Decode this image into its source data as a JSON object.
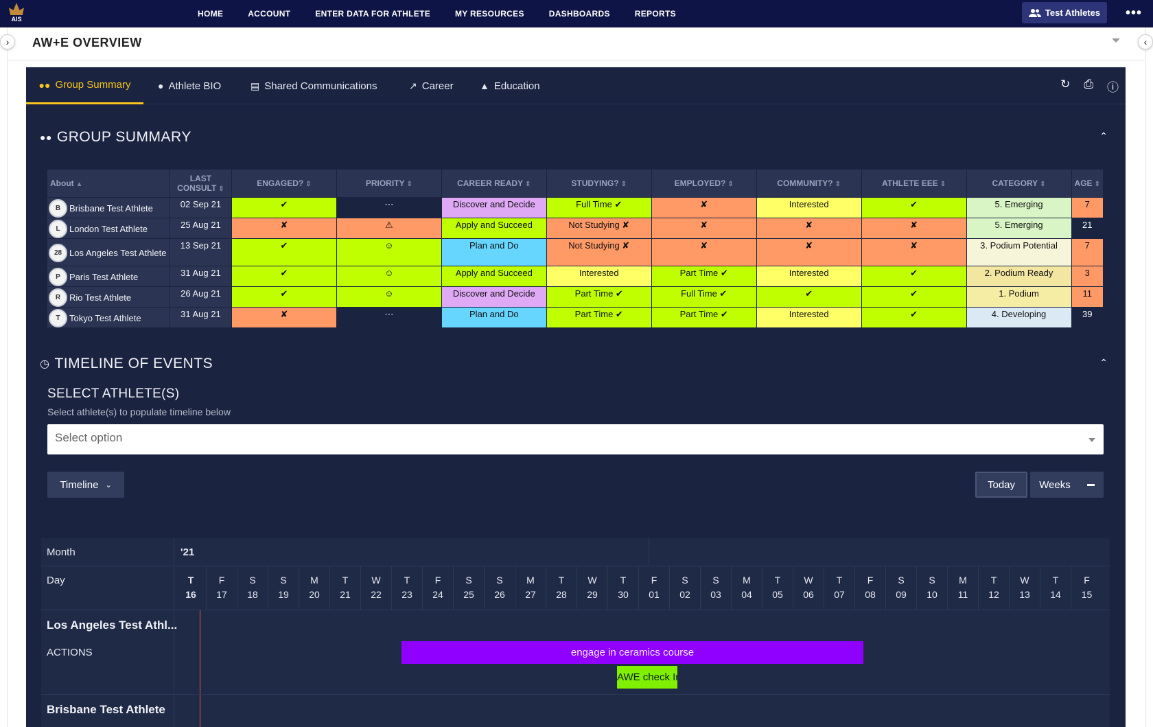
{
  "nav": {
    "logo_text": "AIS",
    "links": [
      "HOME",
      "ACCOUNT",
      "ENTER DATA FOR ATHLETE",
      "MY RESOURCES",
      "DASHBOARDS",
      "REPORTS"
    ],
    "team_button": "Test Athletes",
    "more": "•••"
  },
  "header": {
    "title": "AW+E OVERVIEW"
  },
  "tabs": [
    {
      "label": "Group Summary",
      "icon": "group-icon",
      "active": true
    },
    {
      "label": "Athlete BIO",
      "icon": "person-icon"
    },
    {
      "label": "Shared Communications",
      "icon": "chat-icon"
    },
    {
      "label": "Career",
      "icon": "chart-icon"
    },
    {
      "label": "Education",
      "icon": "graduation-cap-icon"
    }
  ],
  "tools": [
    "refresh-icon",
    "print-icon",
    "info-icon"
  ],
  "group_summary": {
    "title": "GROUP SUMMARY",
    "columns": [
      "About",
      "LAST CONSULT",
      "ENGAGED?",
      "PRIORITY",
      "CAREER READY",
      "STUDYING?",
      "EMPLOYED?",
      "COMMUNITY?",
      "ATHLETE EEE",
      "CATEGORY",
      "AGE"
    ],
    "rows": [
      {
        "name": "Brisbane Test Athlete",
        "date": "02 Sep 21",
        "engaged": "✔",
        "priority": "⋯",
        "career": "Discover and Decide",
        "studying": "Full Time ✔",
        "employed": "✘",
        "community": "Interested",
        "eee": "✔",
        "category": "5. Emerging",
        "age": "7"
      },
      {
        "name": "London Test Athlete",
        "date": "25 Aug 21",
        "engaged": "✘",
        "priority": "⚠",
        "career": "Apply and Succeed",
        "studying": "Not Studying ✘",
        "employed": "✘",
        "community": "✘",
        "eee": "✘",
        "category": "5. Emerging",
        "age": "21"
      },
      {
        "name": "Los Angeles Test Athlete",
        "date": "13 Sep 21",
        "engaged": "✔",
        "priority": "☺",
        "career": "Plan and Do",
        "studying": "Not Studying ✘",
        "employed": "✘",
        "community": "✘",
        "eee": "✘",
        "category": "3. Podium Potential",
        "age": "7"
      },
      {
        "name": "Paris Test Athlete",
        "date": "31 Aug 21",
        "engaged": "✔",
        "priority": "☺",
        "career": "Apply and Succeed",
        "studying": "Interested",
        "employed": "Part Time ✔",
        "community": "Interested",
        "eee": "✔",
        "category": "2. Podium Ready",
        "age": "3"
      },
      {
        "name": "Rio Test Athlete",
        "date": "26 Aug 21",
        "engaged": "✔",
        "priority": "☺",
        "career": "Discover and Decide",
        "studying": "Part Time ✔",
        "employed": "Full Time ✔",
        "community": "✔",
        "eee": "✔",
        "category": "1. Podium",
        "age": "11"
      },
      {
        "name": "Tokyo Test Athlete",
        "date": "31 Aug 21",
        "engaged": "✘",
        "priority": "⋯",
        "career": "Plan and Do",
        "studying": "Part Time ✔",
        "employed": "Part Time ✔",
        "community": "Interested",
        "eee": "✔",
        "category": "4. Developing",
        "age": "39"
      }
    ]
  },
  "timeline_section": {
    "title": "TIMELINE OF EVENTS",
    "select_title": "SELECT ATHLETE(S)",
    "select_sub": "Select athlete(s) to populate timeline below",
    "select_placeholder": "Select option",
    "timeline_btn": "Timeline",
    "today_btn": "Today",
    "weeks_btn": "Weeks",
    "month_label": "Month",
    "day_label": "Day",
    "month_value": "'21",
    "days": [
      [
        "T",
        "16"
      ],
      [
        "F",
        "17"
      ],
      [
        "S",
        "18"
      ],
      [
        "S",
        "19"
      ],
      [
        "M",
        "20"
      ],
      [
        "T",
        "21"
      ],
      [
        "W",
        "22"
      ],
      [
        "T",
        "23"
      ],
      [
        "F",
        "24"
      ],
      [
        "S",
        "25"
      ],
      [
        "S",
        "26"
      ],
      [
        "M",
        "27"
      ],
      [
        "T",
        "28"
      ],
      [
        "W",
        "29"
      ],
      [
        "T",
        "30"
      ],
      [
        "F",
        "01"
      ],
      [
        "S",
        "02"
      ],
      [
        "S",
        "03"
      ],
      [
        "M",
        "04"
      ],
      [
        "T",
        "05"
      ],
      [
        "W",
        "06"
      ],
      [
        "T",
        "07"
      ],
      [
        "F",
        "08"
      ],
      [
        "S",
        "09"
      ],
      [
        "S",
        "10"
      ],
      [
        "M",
        "11"
      ],
      [
        "T",
        "12"
      ],
      [
        "W",
        "13"
      ],
      [
        "T",
        "14"
      ],
      [
        "F",
        "15"
      ]
    ],
    "athlete1": "Los Angeles Test Athl...",
    "actions": "ACTIONS",
    "event1": "engage in ceramics course",
    "event2": "AWE check Ir",
    "athlete2": "Brisbane Test Athlete"
  }
}
